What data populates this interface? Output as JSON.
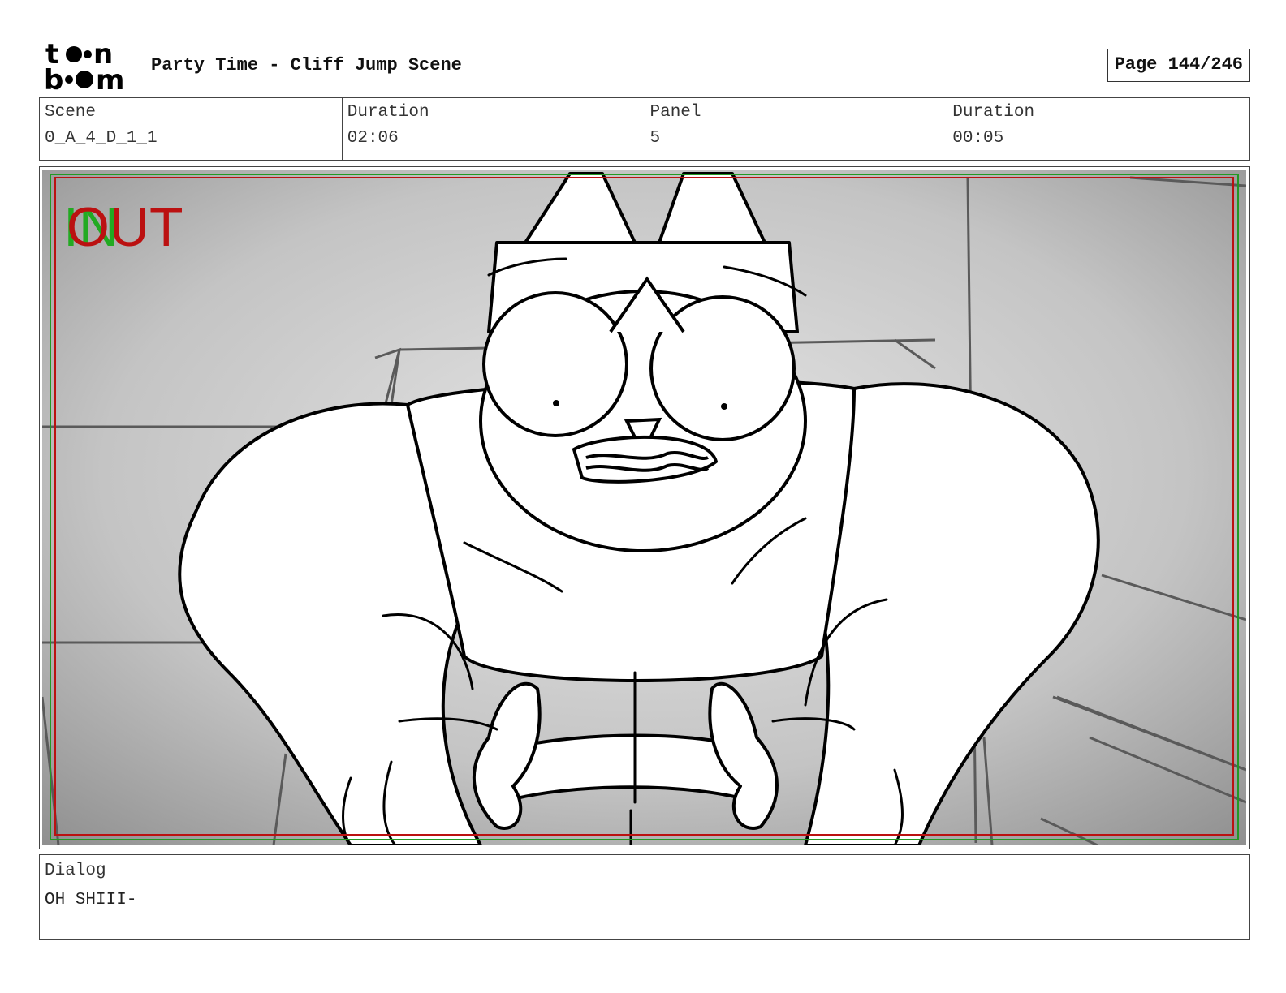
{
  "header": {
    "logo_top": "toon",
    "logo_bottom": "boom",
    "title": "Party Time - Cliff Jump Scene",
    "page_label": "Page 144/246"
  },
  "info": {
    "scene_label": "Scene",
    "scene_value": "0_A_4_D_1_1",
    "scene_duration_label": "Duration",
    "scene_duration_value": "02:06",
    "panel_label": "Panel",
    "panel_value": "5",
    "panel_duration_label": "Duration",
    "panel_duration_value": "00:05"
  },
  "panel": {
    "in_marker": "IN",
    "out_marker": "OUT",
    "in_color": "#22aa22",
    "out_color": "#bb1111",
    "safe_frame_colors": [
      "#bb1111",
      "#229922"
    ]
  },
  "dialog": {
    "label": "Dialog",
    "text": "OH SHIII-"
  }
}
